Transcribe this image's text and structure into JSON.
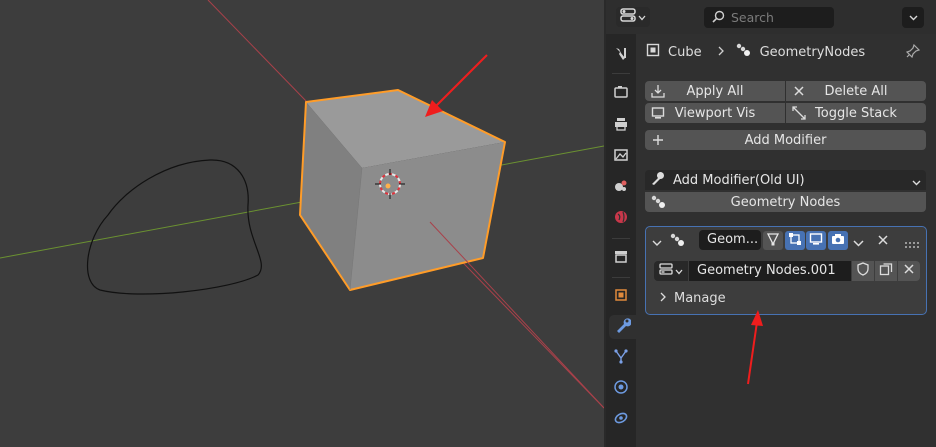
{
  "properties": {
    "search": {
      "placeholder": "Search"
    },
    "breadcrumb": {
      "object": "Cube",
      "modifier": "GeometryNodes"
    },
    "toolbar": {
      "apply_all": "Apply All",
      "delete_all": "Delete All",
      "viewport_vis": "Viewport Vis",
      "toggle_stack": "Toggle Stack",
      "add_modifier": "Add Modifier"
    },
    "old_ui": {
      "dropdown_label": "Add Modifier(Old UI)",
      "geometry_nodes_button": "Geometry Nodes"
    },
    "modifier": {
      "name": "Geom...",
      "node_group": "Geometry Nodes.001",
      "manage_label": "Manage"
    },
    "tabs": [
      "tool",
      "render",
      "output",
      "view-layer",
      "scene",
      "world",
      "collection",
      "object",
      "modifiers",
      "particles",
      "physics",
      "constraints"
    ],
    "active_tab": "modifiers"
  },
  "colors": {
    "accent": "#4772b3",
    "selection_outline": "#ff9c28",
    "annotation_arrow": "#ef1d1d",
    "x_axis": "#b0434d",
    "y_axis": "#6b9231",
    "panel_bg": "#303030",
    "viewport_bg": "#3d3d3d"
  }
}
